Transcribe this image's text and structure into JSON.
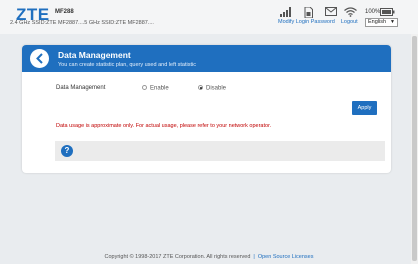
{
  "header": {
    "logo": "ZTE",
    "model": "MF288",
    "ssid_text": "2.4 GHz SSID:ZTE MF2887....5 GHz SSID:ZTE MF2887....",
    "battery": "100%",
    "links": {
      "modify_password": "Modify Login Password",
      "logout": "Logout"
    },
    "language": "English"
  },
  "page": {
    "title": "Data Management",
    "subtitle": "You can create statistic plan, query used and left statistic",
    "data_management_label": "Data Management",
    "option_enable": "Enable",
    "option_disable": "Disable",
    "selected": "Disable",
    "apply_label": "Apply",
    "warning": "Data usage is approximate only. For actual usage, please refer to your network operator.",
    "help_symbol": "?"
  },
  "footer": {
    "copyright": "Copyright © 1998-2017 ZTE Corporation. All rights reserved",
    "separator": "|",
    "open_source": "Open Source Licenses"
  },
  "colors": {
    "accent": "#1f6fbf",
    "warning": "#c00000",
    "background": "#e9ecef"
  },
  "icons": [
    "signal-icon",
    "sim-icon",
    "message-icon",
    "wifi-icon",
    "battery-icon",
    "back-arrow-icon",
    "help-icon"
  ]
}
